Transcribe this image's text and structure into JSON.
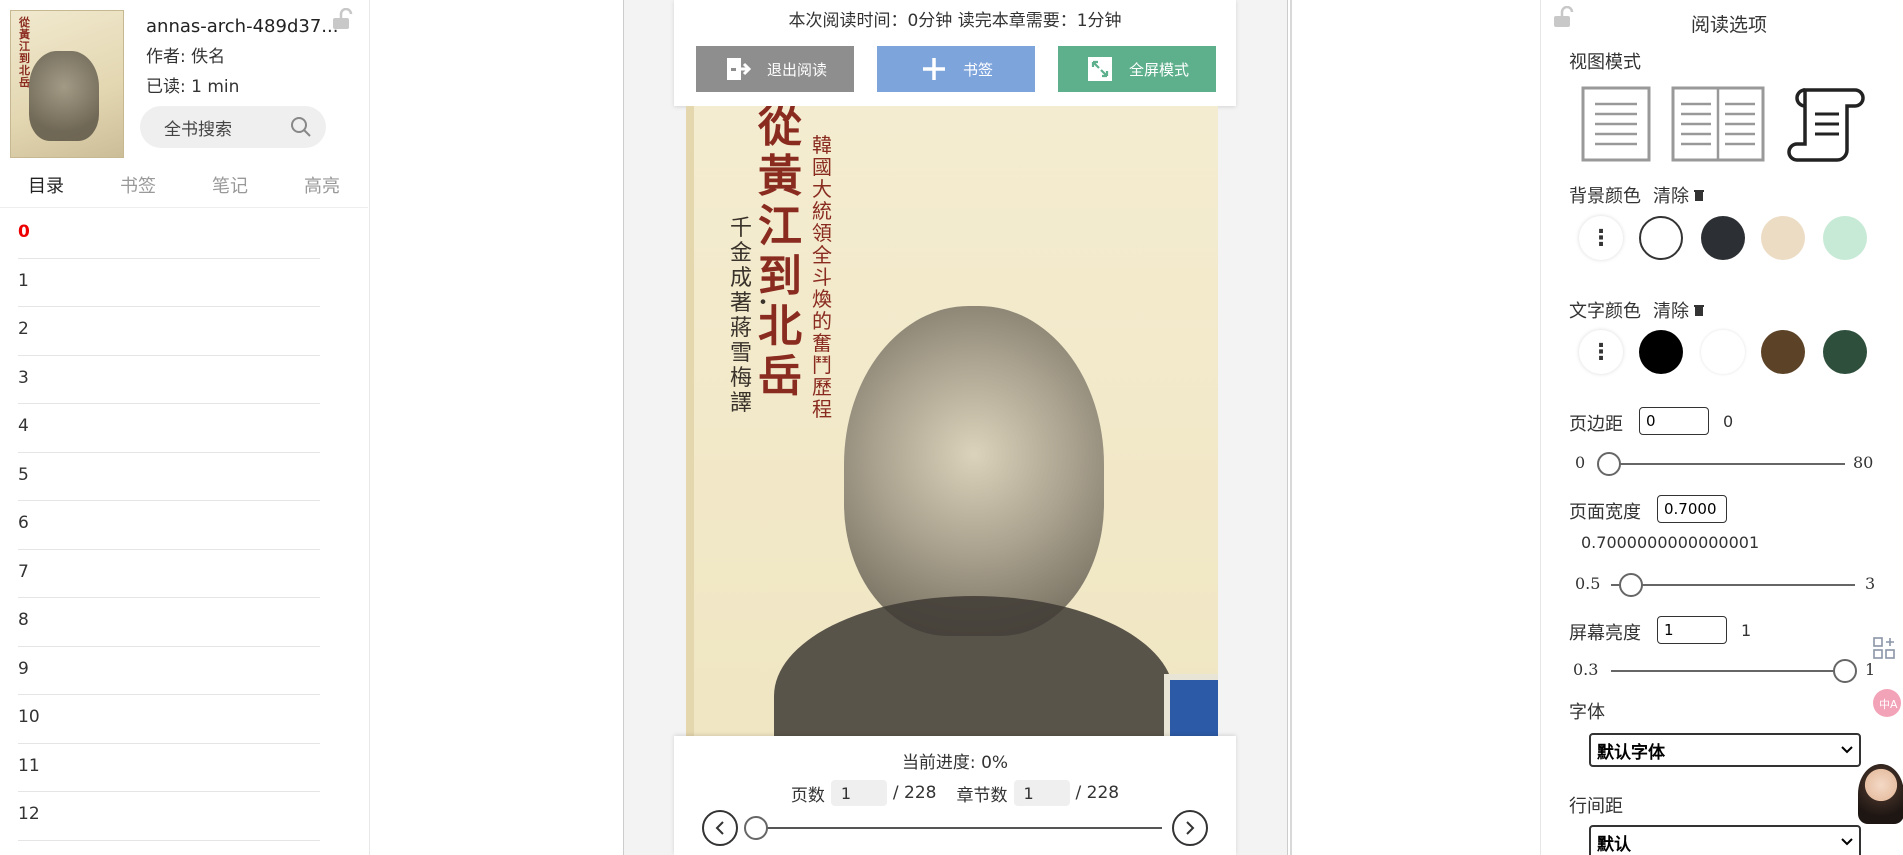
{
  "left_panel": {
    "cover_title": "從黃江到北岳",
    "book_title": "annas-arch-489d37...",
    "author": "作者: 佚名",
    "read_prefix": "已读:",
    "read_value": "1",
    "read_unit": "min",
    "search_label": "全书搜索",
    "tabs": [
      {
        "label": "目录",
        "active": true
      },
      {
        "label": "书签",
        "active": false
      },
      {
        "label": "笔记",
        "active": false
      },
      {
        "label": "高亮",
        "active": false
      }
    ],
    "toc": [
      "0",
      "1",
      "2",
      "3",
      "4",
      "5",
      "6",
      "7",
      "8",
      "9",
      "10",
      "11",
      "12"
    ],
    "toc_current": "0"
  },
  "reader": {
    "reading_time": "本次阅读时间：0分钟   读完本章需要：1分钟",
    "buttons": {
      "exit": "退出阅读",
      "bookmark": "书签",
      "fullscreen": "全屏模式"
    },
    "cover": {
      "title": "從黃江到北岳",
      "subtitle": "韓國大統領全斗煥的奮鬥歷程",
      "author": "千金成著・蔣雪梅譯"
    },
    "progress_text": "当前进度: 0%",
    "page_label": "页数",
    "page_value": "1",
    "page_total": "/ 228",
    "chapter_label": "章节数",
    "chapter_value": "1",
    "chapter_total": "/ 228",
    "page_progress": 0
  },
  "options": {
    "title": "阅读选项",
    "view_mode_label": "视图模式",
    "view_modes": [
      "single-page-icon",
      "double-page-icon",
      "scroll-icon"
    ],
    "bg_color_label": "背景颜色",
    "clear_label": "清除",
    "bg_colors": [
      "#ffffff",
      "#2c2f33",
      "#ecdcc4",
      "#c6ead5"
    ],
    "text_color_label": "文字颜色",
    "text_colors": [
      "#000000",
      "#ffffff",
      "#5c4328",
      "#2f4f3d"
    ],
    "margin_label": "页边距",
    "margin_input": "0",
    "margin_value": "0",
    "margin_min": "0",
    "margin_max": "80",
    "margin_level": 0,
    "width_label": "页面宽度",
    "width_input": "0.7000",
    "width_value": "0.7000000000000001",
    "width_min": "0.5",
    "width_max": "3",
    "width_level": 0.7,
    "brightness_label": "屏幕亮度",
    "brightness_input": "1",
    "brightness_value": "1",
    "brightness_min": "0.3",
    "brightness_max": "1",
    "brightness_level": 1,
    "font_label": "字体",
    "font_select": "默认字体",
    "line_height_label": "行间距",
    "line_height_select": "默认"
  }
}
